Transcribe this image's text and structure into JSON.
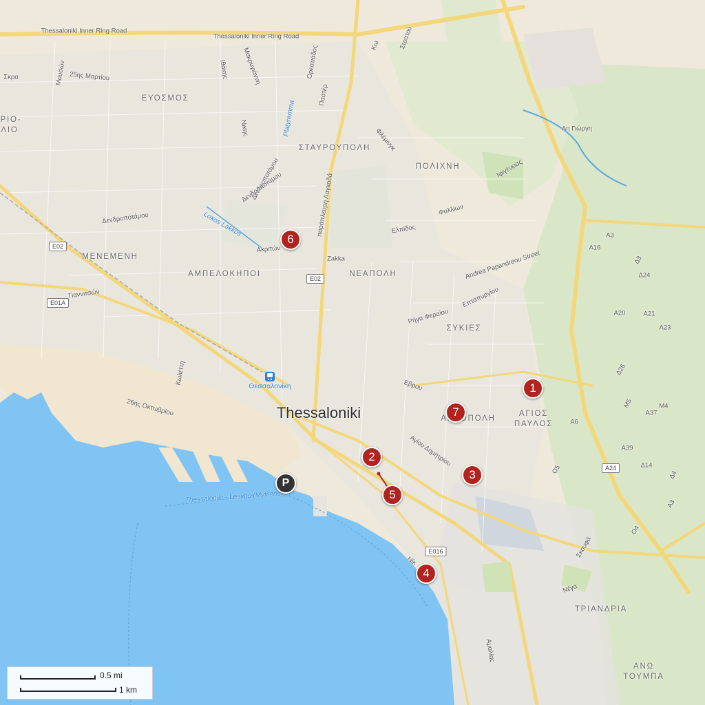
{
  "map": {
    "city": "Thessaloniki",
    "colors": {
      "land": "#efe9dc",
      "sea": "#7fc4f2",
      "park": "#d7e8c4",
      "road_major": "#f3d77a",
      "marker": "#b0231f",
      "parking": "#333333"
    }
  },
  "markers": [
    {
      "label": "1"
    },
    {
      "label": "2"
    },
    {
      "label": "3"
    },
    {
      "label": "4"
    },
    {
      "label": "5"
    },
    {
      "label": "6"
    },
    {
      "label": "7"
    }
  ],
  "parking": {
    "label": "P",
    "icon": "parking-icon"
  },
  "station": {
    "name": "Θεσσαλονίκη",
    "icon": "train-station-icon"
  },
  "districts": [
    "ΕΥΟΣΜΟΣ",
    "ΣΤΑΥΡΟΥΠΟΛΗ",
    "ΠΟΛΙΧΝΗ",
    "ΜΕΝΕΜΕΝΗ",
    "ΑΜΠΕΛΟΚΗΠΟΙ",
    "ΝΕΑΠΟΛΗ",
    "ΣΥΚΙΕΣ",
    "ΑΓΙΟΣ",
    "ΠΑΥΛΟΣ",
    "ΑΚΡΟΠΟΛΗ",
    "ΤΡΙΑΝΔΡΙΑ",
    "ΑΝΩ",
    "ΤΟΥΜΠΑ",
    "ΡΙΟ-",
    "ΛΙΟ"
  ],
  "roads": [
    "Thessaloniki Inner Ring Road",
    "Thessaloniki Inner Ring Road",
    "25ης Μαρτίου",
    "Σκρα",
    "Μουσών",
    "Μακρυγιάννη",
    "Ιθάκης",
    "Ορεστιάδος",
    "Παστέρ",
    "Κω",
    "Στρατού",
    "Νικης",
    "Φλέμινγκ",
    "Δενδροποτάμου",
    "Δενδροποτάμου",
    "Δενδροποτάμου",
    "Ακριτών",
    "Zakka",
    "παράπλευρη Λαγκαδά",
    "Ελπίδος",
    "Φυλλίων",
    "Ιφιγένειας",
    "Αη Γιώργη",
    "Andrea Papandreou Street",
    "Επταπυργίου",
    "Ρήγα Φεραίου",
    "Γιαννιτσών",
    "Κωλέττη",
    "26ης Οκτωβρίου",
    "Εβρου",
    "Αγίου Δημητρίου",
    "Σκουφά",
    "Νίκ",
    "Νέγα",
    "Αμαλίας"
  ],
  "route_labels": [
    "Platyremma",
    "Loxos Lakkos",
    "Thessaloniki - Lesvos (Mytilene)"
  ],
  "shields": [
    "E02",
    "E02",
    "E01A",
    "E016",
    "A24",
    "A16",
    "A3",
    "Δ3",
    "Δ24",
    "A20",
    "A21",
    "A23",
    "Δ26",
    "M5",
    "M4",
    "A37",
    "A6",
    "A39",
    "Δ14",
    "Δ4",
    "A3",
    "Ο4",
    "Ο5"
  ],
  "scale": {
    "imperial": "0.5 mi",
    "metric": "1 km"
  }
}
